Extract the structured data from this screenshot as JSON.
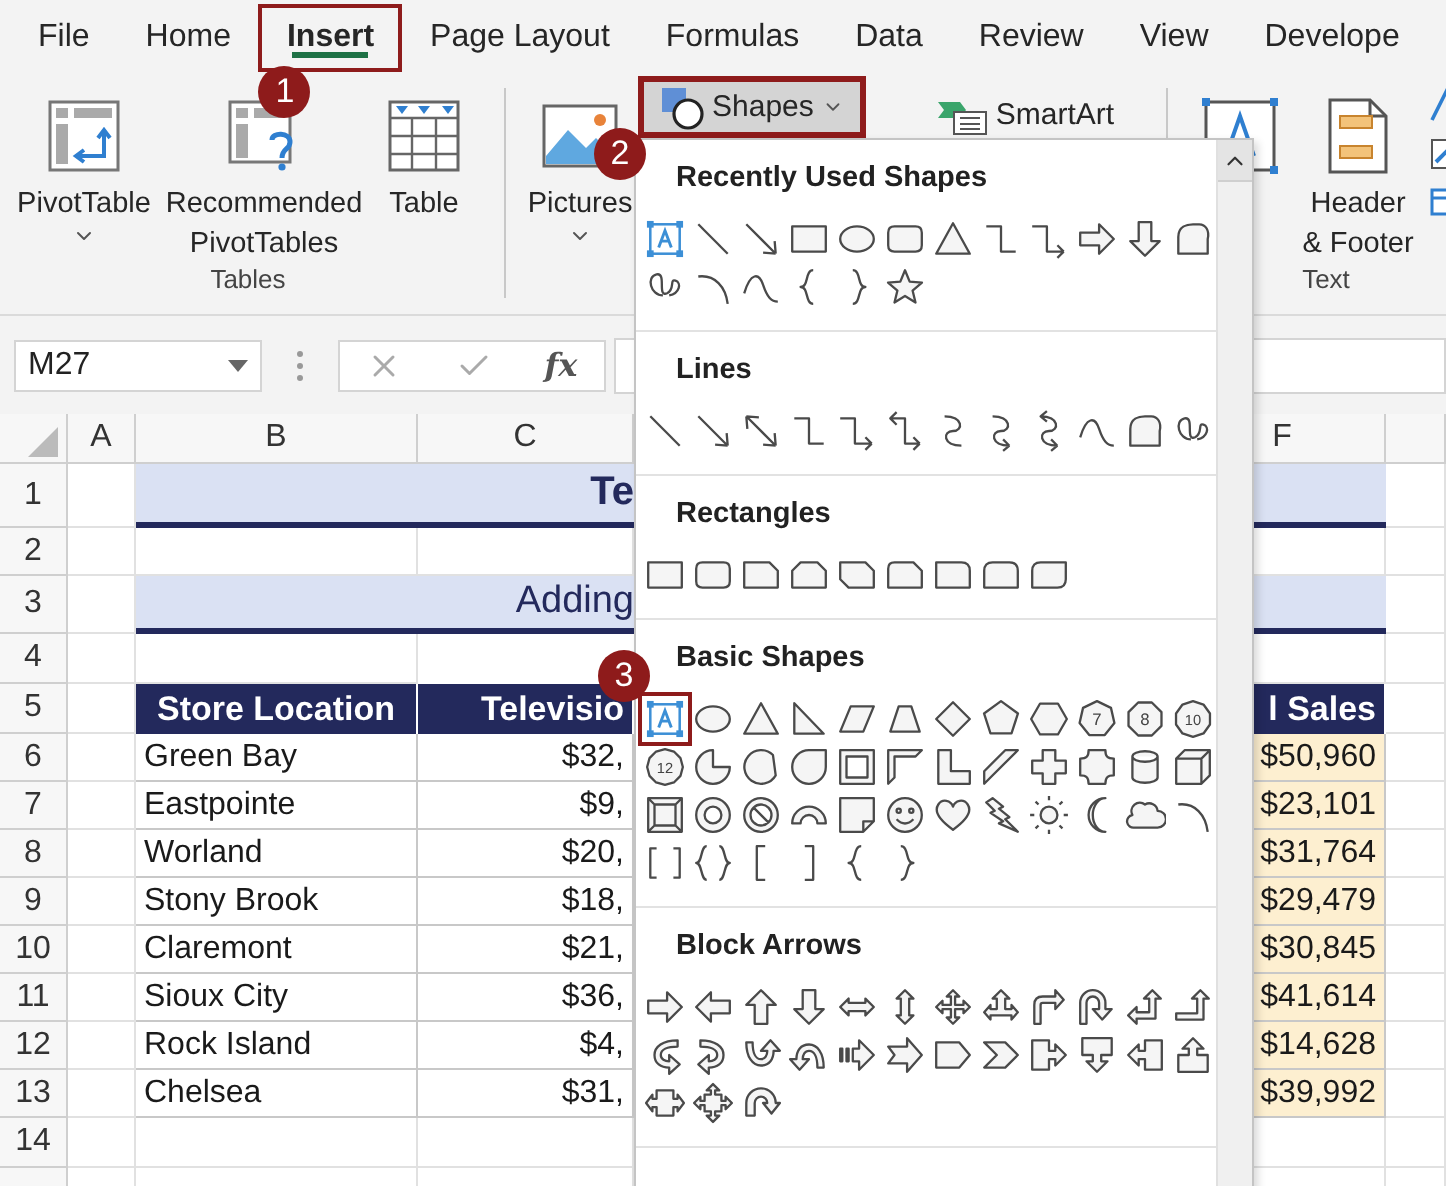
{
  "tabs": [
    {
      "label": "File",
      "selected": false,
      "highlighted": false
    },
    {
      "label": "Home",
      "selected": false,
      "highlighted": false
    },
    {
      "label": "Insert",
      "selected": true,
      "highlighted": true,
      "callout": "1"
    },
    {
      "label": "Page Layout",
      "selected": false,
      "highlighted": false
    },
    {
      "label": "Formulas",
      "selected": false,
      "highlighted": false
    },
    {
      "label": "Data",
      "selected": false,
      "highlighted": false
    },
    {
      "label": "Review",
      "selected": false,
      "highlighted": false
    },
    {
      "label": "View",
      "selected": false,
      "highlighted": false
    },
    {
      "label": "Develope",
      "selected": false,
      "highlighted": false
    }
  ],
  "ribbon": {
    "groups": [
      {
        "label": "Tables",
        "buttons": [
          {
            "kind": "pivot_table",
            "label": "PivotTable",
            "dropdown": true
          },
          {
            "kind": "recommended_pivot",
            "label": "Recommended PivotTables",
            "dropdown": false
          },
          {
            "kind": "table",
            "label": "Table",
            "dropdown": false
          }
        ]
      },
      {
        "buttons": [
          {
            "kind": "pictures",
            "label": "Pictures",
            "dropdown": true
          },
          {
            "kind": "shapes",
            "label": "Shapes",
            "dropdown": true,
            "expanded": true,
            "highlighted": true,
            "callout": "2"
          },
          {
            "kind": "smartart",
            "label": "SmartArt",
            "dropdown": false
          }
        ]
      },
      {
        "label": "Text",
        "buttons": [
          {
            "kind": "text_box"
          },
          {
            "kind": "header_footer",
            "label": "Header & Footer",
            "dropdown": false
          },
          {
            "kind": "more"
          }
        ]
      }
    ]
  },
  "formula_bar": {
    "name_box": "M27",
    "function_label": "fx"
  },
  "sheet": {
    "column_headers": [
      "A",
      "B",
      "C",
      "F"
    ],
    "row_numbers": [
      "1",
      "2",
      "3",
      "4",
      "5",
      "6",
      "7",
      "8",
      "9",
      "10",
      "11",
      "12",
      "13",
      "14"
    ],
    "title": "Te",
    "subtitle": "Adding",
    "table": {
      "headers": [
        "Store Location",
        "Televisio",
        "l Sales"
      ],
      "rows": [
        [
          "Green Bay",
          "$32,",
          "$50,960"
        ],
        [
          "Eastpointe",
          "$9,",
          "$23,101"
        ],
        [
          "Worland",
          "$20,",
          "$31,764"
        ],
        [
          "Stony Brook",
          "$18,",
          "$29,479"
        ],
        [
          "Claremont",
          "$21,",
          "$30,845"
        ],
        [
          "Sioux City",
          "$36,",
          "$41,614"
        ],
        [
          "Rock Island",
          "$4,",
          "$14,628"
        ],
        [
          "Chelsea",
          "$31,",
          "$39,992"
        ]
      ]
    }
  },
  "shapes_menu": {
    "sections": [
      {
        "kind": "recent",
        "heading": "Recently Used Shapes"
      },
      {
        "kind": "lines",
        "heading": "Lines"
      },
      {
        "kind": "rectangles",
        "heading": "Rectangles"
      },
      {
        "kind": "basic",
        "heading": "Basic Shapes",
        "polygon_labels": [
          "7",
          "8",
          "10",
          "12"
        ],
        "highlight_first": true,
        "callout": "3"
      },
      {
        "kind": "block_arrows",
        "heading": "Block Arrows"
      }
    ]
  }
}
